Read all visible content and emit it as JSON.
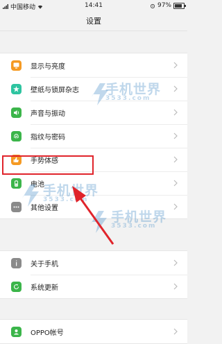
{
  "status_bar": {
    "carrier": "中国移动",
    "time": "14:41",
    "battery_percent": "97%"
  },
  "header": {
    "title": "设置"
  },
  "settings_group_1": [
    {
      "label": "显示与亮度",
      "icon": "display-icon",
      "color": "#f59a23"
    },
    {
      "label": "壁纸与锁屏杂志",
      "icon": "wallpaper-icon",
      "color": "#2ec4a0"
    },
    {
      "label": "声音与振动",
      "icon": "sound-icon",
      "color": "#3bb54a"
    },
    {
      "label": "指纹与密码",
      "icon": "fingerprint-icon",
      "color": "#3bb54a"
    },
    {
      "label": "手势体感",
      "icon": "gesture-icon",
      "color": "#f59a23"
    },
    {
      "label": "电池",
      "icon": "battery-icon",
      "color": "#3bb54a"
    },
    {
      "label": "其他设置",
      "icon": "more-icon",
      "color": "#8a8a8a"
    }
  ],
  "settings_group_2": [
    {
      "label": "关于手机",
      "icon": "info-icon",
      "color": "#8a8a8a"
    },
    {
      "label": "系统更新",
      "icon": "update-icon",
      "color": "#3bb54a"
    }
  ],
  "settings_group_3": [
    {
      "label": "OPPO帐号",
      "icon": "account-icon",
      "color": "#3bb54a"
    }
  ],
  "watermark": {
    "brand": "手机世界",
    "domain": "3533.com"
  },
  "annotation": {
    "color": "#e0242b"
  }
}
